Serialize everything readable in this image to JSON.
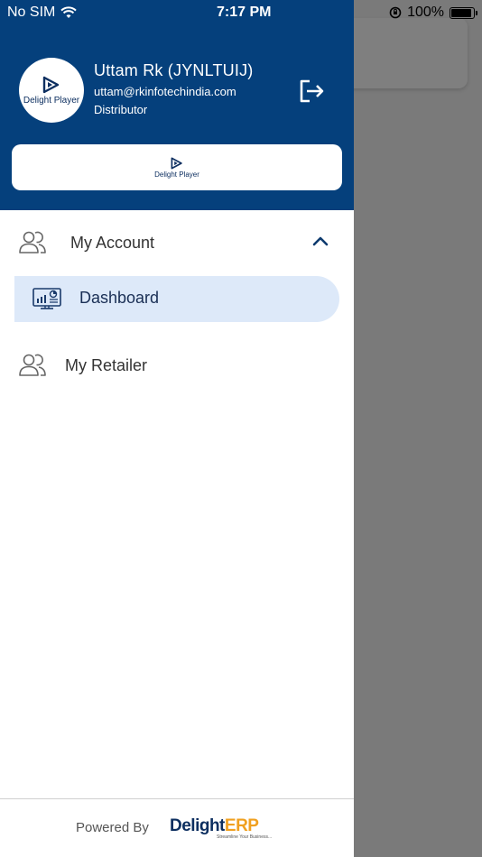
{
  "status_bar": {
    "carrier": "No SIM",
    "time": "7:17 PM",
    "battery": "100%",
    "battery_level": 1.0
  },
  "drawer": {
    "header": {
      "avatar_logo_text": "Delight Player",
      "user_name": "Uttam Rk (JYNLTUIJ)",
      "email": "uttam@rkinfotechindia.com",
      "role": "Distributor",
      "banner_logo_text": "Delight Player",
      "background_color": "#05407c"
    },
    "menu": {
      "my_account": "My Account",
      "dashboard": "Dashboard",
      "my_retailer": "My Retailer",
      "active_item_color": "#dde9f9"
    },
    "footer": {
      "powered_by": "Powered By",
      "erp_brand_a": "Delight",
      "erp_brand_b": "ERP",
      "erp_tagline": "Streamline Your Business..."
    }
  },
  "icons": {
    "wifi": "wifi-icon",
    "rotation_lock": "rotation-lock-icon",
    "battery": "battery-icon",
    "logout": "logout-icon",
    "users": "users-icon",
    "chevron": "chevron-up-icon",
    "dashboard": "dashboard-monitor-icon",
    "play_logo": "play-logo-icon"
  }
}
